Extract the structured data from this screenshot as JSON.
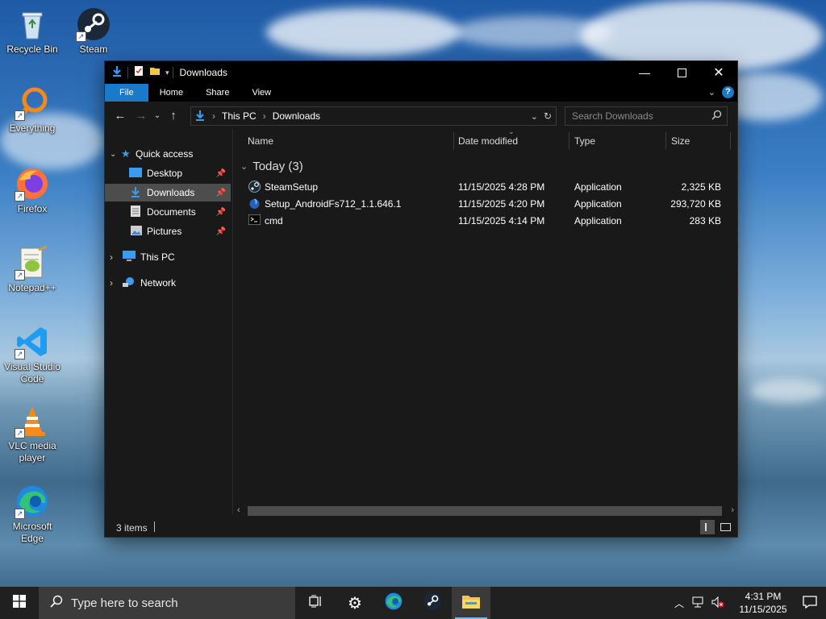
{
  "desktop": {
    "icons": [
      {
        "label": "Recycle Bin",
        "icon": "recycle-bin-icon"
      },
      {
        "label": "Steam",
        "icon": "steam-icon"
      },
      {
        "label": "Everything",
        "icon": "everything-search-icon"
      },
      {
        "label": "Firefox",
        "icon": "firefox-icon"
      },
      {
        "label": "Notepad++",
        "icon": "notepad-plus-plus-icon"
      },
      {
        "label": "Visual Studio Code",
        "icon": "vscode-icon"
      },
      {
        "label": "VLC media player",
        "icon": "vlc-icon"
      },
      {
        "label": "Microsoft Edge",
        "icon": "edge-icon"
      }
    ]
  },
  "explorer": {
    "title": "Downloads",
    "ribbon_tabs": [
      "File",
      "Home",
      "Share",
      "View"
    ],
    "help_label": "?",
    "breadcrumb": [
      "This PC",
      "Downloads"
    ],
    "search_placeholder": "Search Downloads",
    "sidebar": {
      "quick_access": "Quick access",
      "items": [
        "Desktop",
        "Downloads",
        "Documents",
        "Pictures"
      ],
      "this_pc": "This PC",
      "network": "Network"
    },
    "columns": [
      "Name",
      "Date modified",
      "Type",
      "Size"
    ],
    "group_label": "Today (3)",
    "files": [
      {
        "name": "SteamSetup",
        "date": "11/15/2025 4:28 PM",
        "type": "Application",
        "size": "2,325 KB",
        "icon": "steam-setup-icon"
      },
      {
        "name": "Setup_AndroidFs712_1.1.646.1",
        "date": "11/15/2025 4:20 PM",
        "type": "Application",
        "size": "293,720 KB",
        "icon": "installer-icon"
      },
      {
        "name": "cmd",
        "date": "11/15/2025 4:14 PM",
        "type": "Application",
        "size": "283 KB",
        "icon": "cmd-icon"
      }
    ],
    "status": "3 items"
  },
  "taskbar": {
    "search_placeholder": "Type here to search",
    "time": "4:31 PM",
    "date": "11/15/2025"
  },
  "colors": {
    "accent": "#1979ca",
    "window_bg": "#191919",
    "selection": "#4d4d4d",
    "taskbar": "#202020"
  }
}
